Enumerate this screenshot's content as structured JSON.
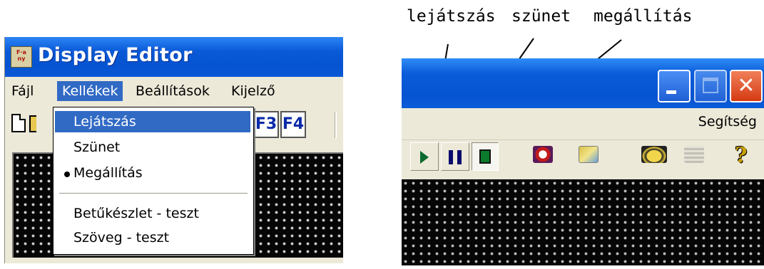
{
  "annotations": {
    "play": "lejátszás",
    "pause": "szünet",
    "stop": "megállítás"
  },
  "left_window": {
    "app_icon_text": "Flag",
    "title": "Display Editor",
    "menu": [
      {
        "label": "Fájl"
      },
      {
        "label": "Kellékek"
      },
      {
        "label": "Beállítások"
      },
      {
        "label": "Kijelző"
      }
    ],
    "toolbar": {
      "fkeys": [
        "F3",
        "F4"
      ]
    },
    "dropdown": [
      {
        "label": "Lejátszás",
        "highlighted": true
      },
      {
        "label": "Szünet"
      },
      {
        "label": "Megállítás",
        "checked": true
      },
      {
        "label": "Betűkészlet - teszt"
      },
      {
        "label": "Szöveg - teszt"
      }
    ]
  },
  "right_window": {
    "window_buttons": [
      "minimize",
      "maximize",
      "close"
    ],
    "close_glyph": "✕",
    "menu_right": "Segítség",
    "toolbar_icons": [
      "play-icon",
      "pause-icon",
      "stop-icon",
      "clock-icon",
      "mail-icon",
      "telephone-icon",
      "antenna-icon",
      "help-icon"
    ],
    "help_glyph": "?"
  },
  "colors": {
    "titlebar_blue": "#0553d1",
    "menu_highlight": "#316ac5",
    "window_bg": "#ece9d8",
    "led_background": "#060606",
    "led_dot": "#cfcfcf",
    "close_button": "#d43a12"
  }
}
